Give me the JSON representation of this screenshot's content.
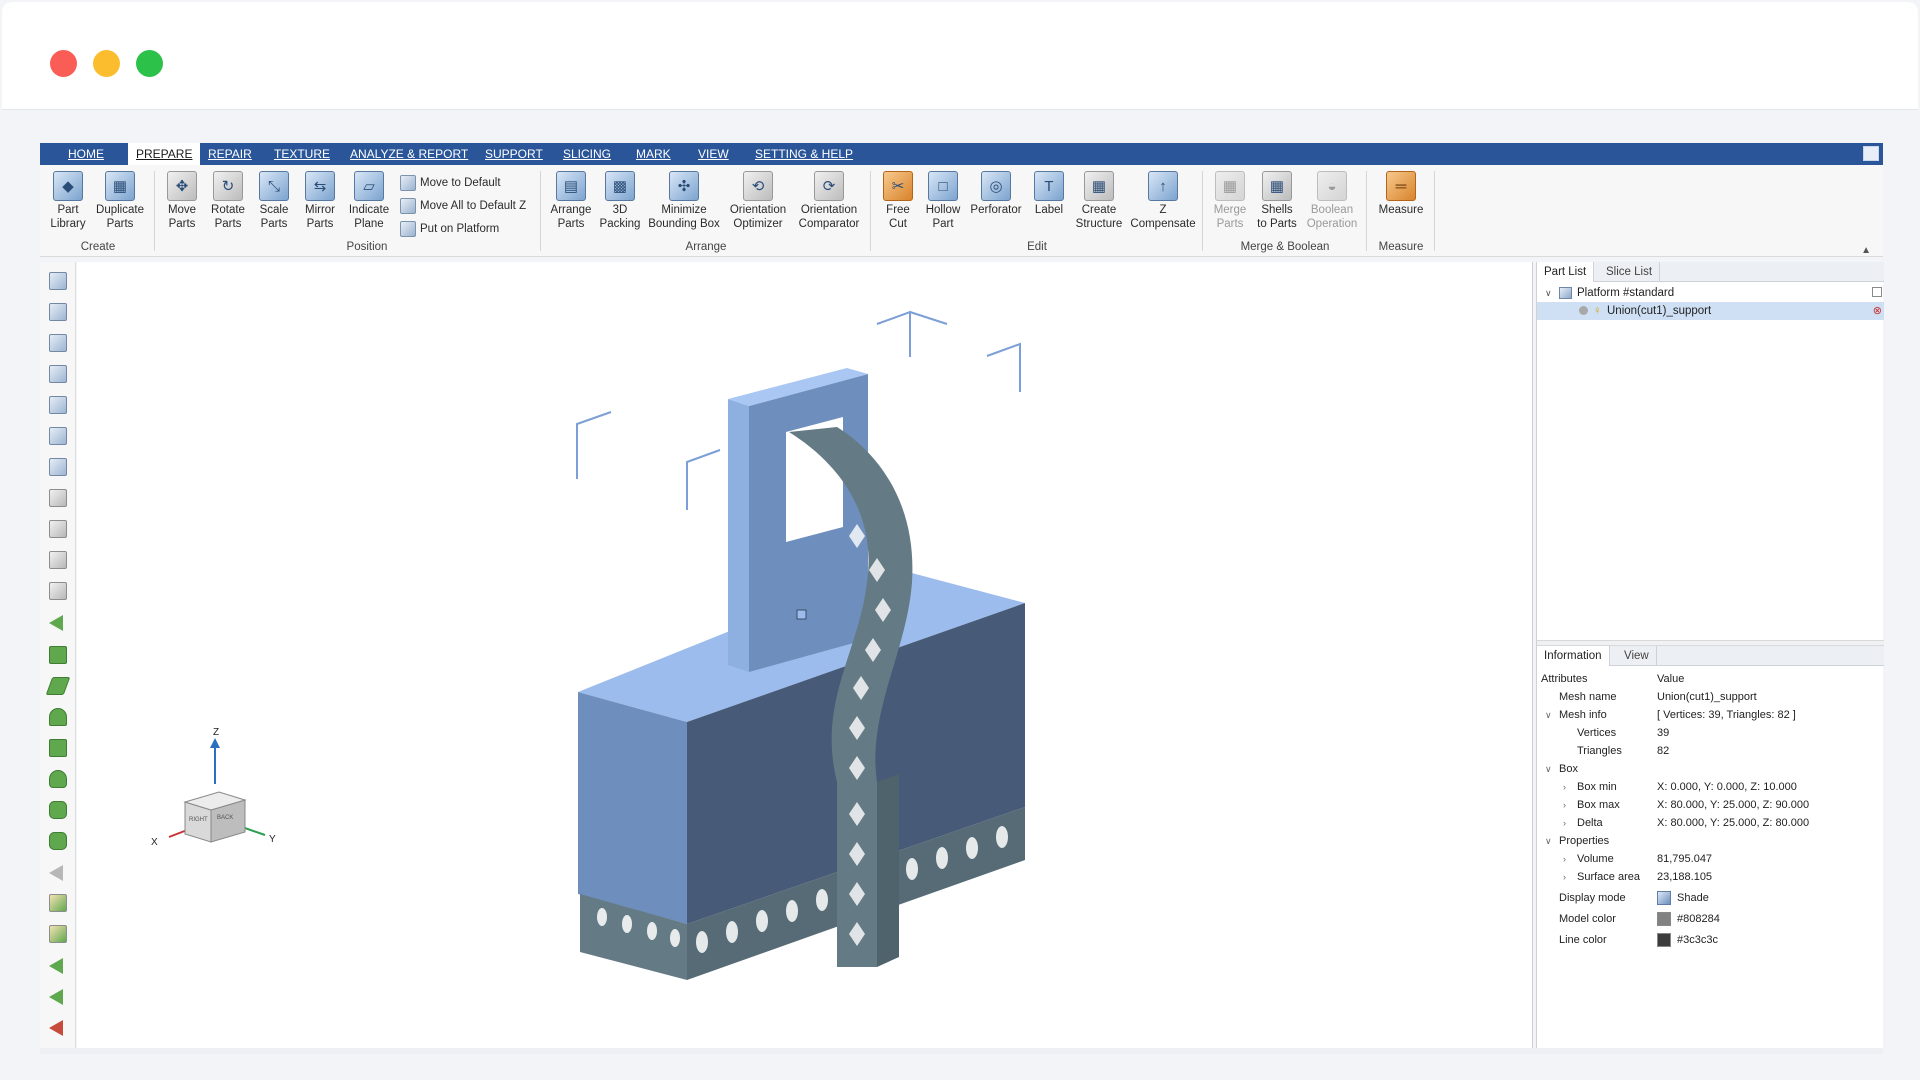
{
  "menu": {
    "tabs": [
      {
        "label": "HOME",
        "active": false
      },
      {
        "label": "PREPARE",
        "active": true
      },
      {
        "label": "REPAIR",
        "active": false
      },
      {
        "label": "TEXTURE",
        "active": false
      },
      {
        "label": "ANALYZE & REPORT",
        "active": false
      },
      {
        "label": "SUPPORT",
        "active": false
      },
      {
        "label": "SLICING",
        "active": false
      },
      {
        "label": "MARK",
        "active": false
      },
      {
        "label": "VIEW",
        "active": false
      },
      {
        "label": "SETTING & HELP",
        "active": false
      }
    ]
  },
  "ribbon": {
    "groups": {
      "create": "Create",
      "position": "Position",
      "arrange": "Arrange",
      "edit": "Edit",
      "merge": "Merge & Boolean",
      "measure": "Measure"
    },
    "buttons": {
      "part_library": [
        "Part",
        "Library"
      ],
      "duplicate_parts": [
        "Duplicate",
        "Parts"
      ],
      "move_parts": [
        "Move",
        "Parts"
      ],
      "rotate_parts": [
        "Rotate",
        "Parts"
      ],
      "scale_parts": [
        "Scale",
        "Parts"
      ],
      "mirror_parts": [
        "Mirror",
        "Parts"
      ],
      "indicate_plane": [
        "Indicate",
        "Plane"
      ],
      "move_to_default": "Move to Default",
      "move_all_default_z": "Move All to Default Z",
      "put_on_platform": "Put on Platform",
      "arrange_parts": [
        "Arrange",
        "Parts"
      ],
      "packing_3d": [
        "3D",
        "Packing"
      ],
      "minimize_bbox": [
        "Minimize",
        "Bounding Box"
      ],
      "orientation_optimizer": [
        "Orientation",
        "Optimizer"
      ],
      "orientation_comparator": [
        "Orientation",
        "Comparator"
      ],
      "free_cut": [
        "Free",
        "Cut"
      ],
      "hollow_part": [
        "Hollow",
        "Part"
      ],
      "perforator": [
        "Perforator",
        ""
      ],
      "label": [
        "Label",
        ""
      ],
      "create_structure": [
        "Create",
        "Structure"
      ],
      "z_compensate": [
        "Z",
        "Compensate"
      ],
      "merge_parts": [
        "Merge",
        "Parts"
      ],
      "shells_to_parts": [
        "Shells",
        "to Parts"
      ],
      "boolean_operation": [
        "Boolean",
        "Operation"
      ],
      "measure": [
        "Measure",
        ""
      ]
    }
  },
  "viewport": {
    "axis_labels": {
      "z": "Z",
      "x": "X",
      "y": "Y"
    },
    "cube_faces": {
      "left": "RIGHT",
      "right": "BACK"
    }
  },
  "part_list": {
    "tabs": [
      "Part List",
      "Slice List"
    ],
    "platform": "Platform #standard",
    "part": "Union(cut1)_support"
  },
  "info_panel": {
    "tabs": [
      "Information",
      "View"
    ],
    "header": {
      "attr": "Attributes",
      "value": "Value"
    },
    "mesh_name": {
      "label": "Mesh name",
      "value": "Union(cut1)_support"
    },
    "mesh_info": {
      "label": "Mesh info",
      "value": "[ Vertices: 39, Triangles: 82 ]"
    },
    "vertices": {
      "label": "Vertices",
      "value": "39"
    },
    "triangles": {
      "label": "Triangles",
      "value": "82"
    },
    "box": {
      "label": "Box"
    },
    "box_min": {
      "label": "Box min",
      "value": "X: 0.000, Y: 0.000, Z: 10.000"
    },
    "box_max": {
      "label": "Box max",
      "value": "X: 80.000, Y: 25.000, Z: 90.000"
    },
    "delta": {
      "label": "Delta",
      "value": "X: 80.000, Y: 25.000, Z: 80.000"
    },
    "properties": {
      "label": "Properties"
    },
    "volume": {
      "label": "Volume",
      "value": "81,795.047"
    },
    "surface_area": {
      "label": "Surface area",
      "value": "23,188.105"
    },
    "display_mode": {
      "label": "Display mode",
      "value": "Shade"
    },
    "model_color": {
      "label": "Model color",
      "value": "#808284"
    },
    "line_color": {
      "label": "Line color",
      "value": "#3c3c3c"
    }
  },
  "colors": {
    "menubar": "#2a5699",
    "model_face_front": "#475a78",
    "model_face_left": "#6e8fbd",
    "model_face_top": "#9bbcec",
    "support": "#647a84",
    "selection": "#cfe0f5"
  }
}
